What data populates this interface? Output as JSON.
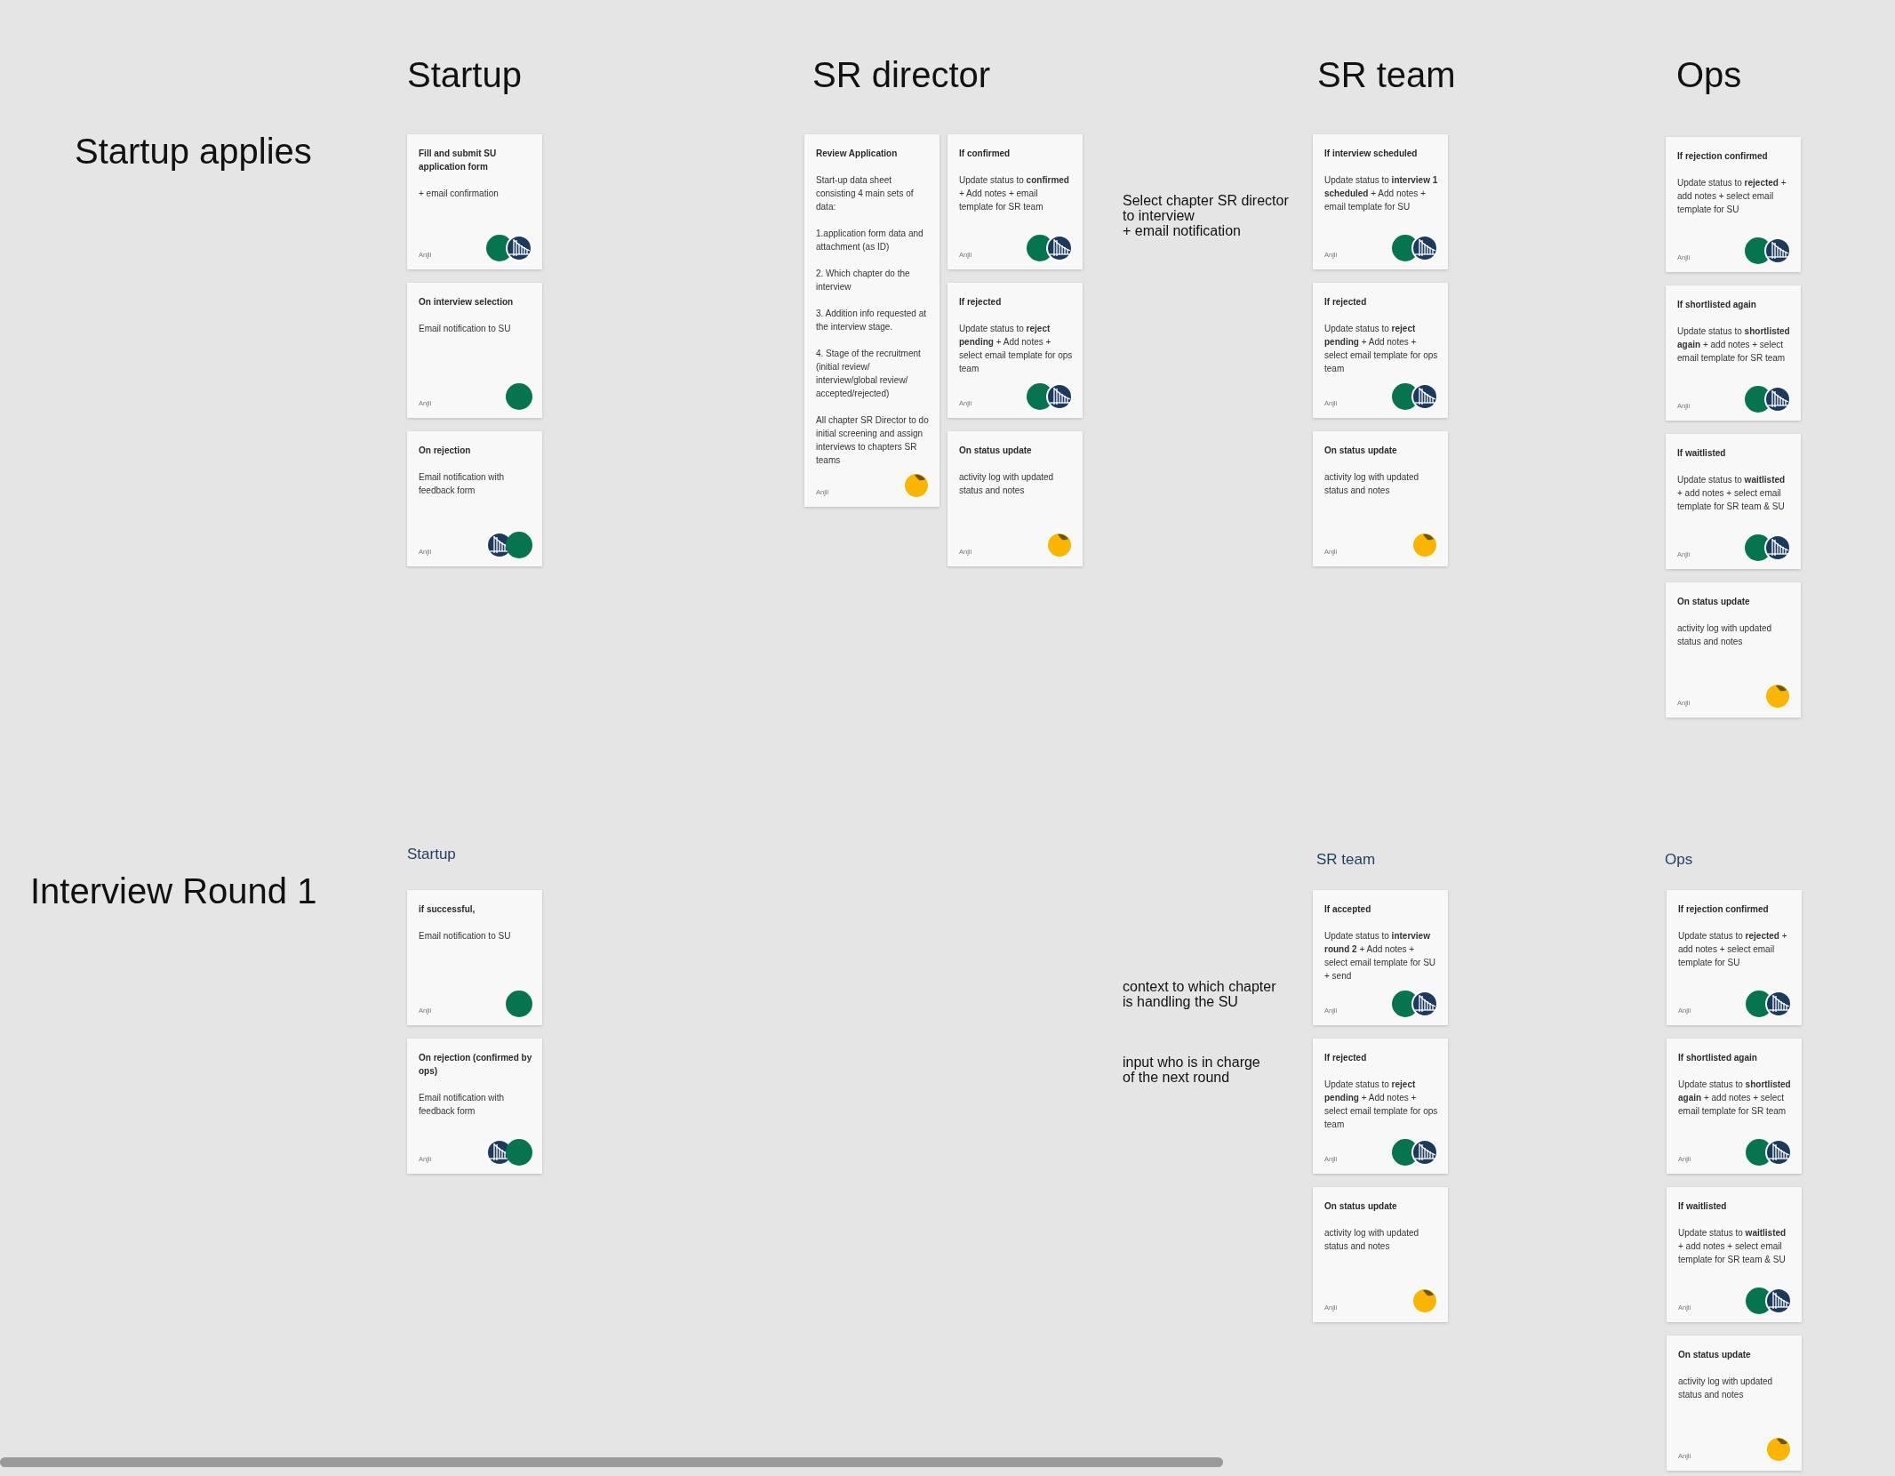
{
  "board": {
    "sections": [
      {
        "title": "Startup applies",
        "columns": [
          {
            "heading": "Startup",
            "stacks": [
              {
                "cards": [
                  {
                    "title": "Fill and submit SU application form",
                    "body": [
                      "+ email confirmation"
                    ],
                    "author": "Anjli",
                    "stamps": [
                      {
                        "kind": "avatar"
                      },
                      {
                        "kind": "bridge"
                      }
                    ]
                  },
                  {
                    "title": "On interview selection",
                    "body": [
                      "Email notification to SU"
                    ],
                    "author": "Anjli",
                    "stamps": [
                      {
                        "kind": "avatar"
                      }
                    ]
                  },
                  {
                    "title": "On rejection",
                    "body": [
                      "Email notification with feedback form"
                    ],
                    "author": "Anjli",
                    "stamps": [
                      {
                        "kind": "bridge"
                      },
                      {
                        "kind": "avatar"
                      }
                    ]
                  }
                ]
              }
            ]
          },
          {
            "heading": "SR director",
            "stacks": [
              {
                "cards": [
                  {
                    "title": "Review Application",
                    "body": [
                      "Start-up data sheet consisting 4 main sets of data:",
                      "1.application form data and attachment (as ID)",
                      "2. Which chapter do the interview",
                      "3. Addition info requested at the interview stage.",
                      "4. Stage of the recruitment (initial review/ interview/global review/ accepted/rejected)",
                      "All chapter SR Director to do initial screening and assign interviews to chapters SR teams"
                    ],
                    "author": "Anjli",
                    "stamps": [
                      {
                        "kind": "sticker"
                      }
                    ]
                  }
                ]
              },
              {
                "cards": [
                  {
                    "title": "If confirmed",
                    "body": [
                      "Update status to **confirmed** + Add notes + email template for SR team"
                    ],
                    "author": "Anjli",
                    "stamps": [
                      {
                        "kind": "avatar"
                      },
                      {
                        "kind": "bridge"
                      }
                    ]
                  },
                  {
                    "title": "If rejected",
                    "body": [
                      "Update status to **reject pending** + Add notes + select email template for ops team"
                    ],
                    "author": "Anjli",
                    "stamps": [
                      {
                        "kind": "avatar"
                      },
                      {
                        "kind": "bridge"
                      }
                    ]
                  },
                  {
                    "title": "On status update",
                    "body": [
                      "activity log with updated status and notes"
                    ],
                    "author": "Anjli",
                    "stamps": [
                      {
                        "kind": "sticker"
                      }
                    ]
                  }
                ]
              }
            ]
          },
          {
            "heading": "SR team",
            "stacks": [
              {
                "cards": [
                  {
                    "title": "If interview scheduled",
                    "body": [
                      "Update status to **interview 1 scheduled** + Add notes + email template for SU"
                    ],
                    "author": "Anjli",
                    "stamps": [
                      {
                        "kind": "avatar"
                      },
                      {
                        "kind": "bridge"
                      }
                    ]
                  },
                  {
                    "title": "If rejected",
                    "body": [
                      "Update status to **reject pending** + Add notes + select email template for ops team"
                    ],
                    "author": "Anjli",
                    "stamps": [
                      {
                        "kind": "avatar"
                      },
                      {
                        "kind": "bridge"
                      }
                    ]
                  },
                  {
                    "title": "On status update",
                    "body": [
                      "activity log with updated status and notes"
                    ],
                    "author": "Anjli",
                    "stamps": [
                      {
                        "kind": "sticker"
                      }
                    ]
                  }
                ]
              }
            ]
          },
          {
            "heading": "Ops",
            "stacks": [
              {
                "cards": [
                  {
                    "title": "If rejection confirmed",
                    "body": [
                      "Update status to **rejected** + add notes + select email template for SU"
                    ],
                    "author": "Anjli",
                    "stamps": [
                      {
                        "kind": "avatar"
                      },
                      {
                        "kind": "bridge"
                      }
                    ]
                  },
                  {
                    "title": "If shortlisted again",
                    "body": [
                      "Update status to **shortlisted again** + add notes + select email template for SR team"
                    ],
                    "author": "Anjli",
                    "stamps": [
                      {
                        "kind": "avatar"
                      },
                      {
                        "kind": "bridge"
                      }
                    ]
                  },
                  {
                    "title": "If waitlisted",
                    "body": [
                      "Update status to **waitlisted** + add notes + select email template for SR team & SU"
                    ],
                    "author": "Anjli",
                    "stamps": [
                      {
                        "kind": "avatar"
                      },
                      {
                        "kind": "bridge"
                      }
                    ]
                  },
                  {
                    "title": "On status update",
                    "body": [
                      "activity log with updated status and notes"
                    ],
                    "author": "Anjli",
                    "stamps": [
                      {
                        "kind": "sticker"
                      }
                    ]
                  }
                ]
              }
            ]
          }
        ],
        "notes": [
          "Select chapter SR director\nto interview\n+ email notification"
        ]
      },
      {
        "title": "Interview Round 1",
        "columns": [
          {
            "heading": "Startup",
            "stacks": [
              {
                "cards": [
                  {
                    "title": "if successful,",
                    "body": [
                      "Email notification to SU"
                    ],
                    "author": "Anjli",
                    "stamps": [
                      {
                        "kind": "avatar"
                      }
                    ]
                  },
                  {
                    "title": "On rejection (confirmed by ops)",
                    "body": [
                      "Email notification with feedback form"
                    ],
                    "author": "Anjli",
                    "stamps": [
                      {
                        "kind": "bridge"
                      },
                      {
                        "kind": "avatar"
                      }
                    ]
                  }
                ]
              }
            ]
          },
          {
            "heading": "SR team",
            "stacks": [
              {
                "cards": [
                  {
                    "title": "If accepted",
                    "body": [
                      "Update status to **interview round 2** + Add notes + select email template for SU + send"
                    ],
                    "author": "Anjli",
                    "stamps": [
                      {
                        "kind": "avatar"
                      },
                      {
                        "kind": "bridge"
                      }
                    ]
                  },
                  {
                    "title": "If rejected",
                    "body": [
                      "Update status to **reject pending** + Add notes + select email template for ops team"
                    ],
                    "author": "Anjli",
                    "stamps": [
                      {
                        "kind": "avatar"
                      },
                      {
                        "kind": "bridge"
                      }
                    ]
                  },
                  {
                    "title": "On status update",
                    "body": [
                      "activity log with updated status and notes"
                    ],
                    "author": "Anjli",
                    "stamps": [
                      {
                        "kind": "sticker"
                      }
                    ]
                  }
                ]
              }
            ]
          },
          {
            "heading": "Ops",
            "stacks": [
              {
                "cards": [
                  {
                    "title": "If rejection confirmed",
                    "body": [
                      "Update status to **rejected** + add notes + select email template for SU"
                    ],
                    "author": "Anjli",
                    "stamps": [
                      {
                        "kind": "avatar"
                      },
                      {
                        "kind": "bridge"
                      }
                    ]
                  },
                  {
                    "title": "If shortlisted again",
                    "body": [
                      "Update status to **shortlisted again** + add notes + select email template for SR team"
                    ],
                    "author": "Anjli",
                    "stamps": [
                      {
                        "kind": "avatar"
                      },
                      {
                        "kind": "bridge"
                      }
                    ]
                  },
                  {
                    "title": "If waitlisted",
                    "body": [
                      "Update status to **waitlisted** + add notes + select email template for SR team & SU"
                    ],
                    "author": "Anjli",
                    "stamps": [
                      {
                        "kind": "avatar"
                      },
                      {
                        "kind": "bridge"
                      }
                    ]
                  },
                  {
                    "title": "On status update",
                    "body": [
                      "activity log with updated status and notes"
                    ],
                    "author": "Anjli",
                    "stamps": [
                      {
                        "kind": "sticker"
                      }
                    ]
                  }
                ]
              }
            ]
          }
        ],
        "notes": [
          "context to which chapter\nis handling the SU",
          "input who is in charge\nof the next round"
        ]
      }
    ]
  }
}
